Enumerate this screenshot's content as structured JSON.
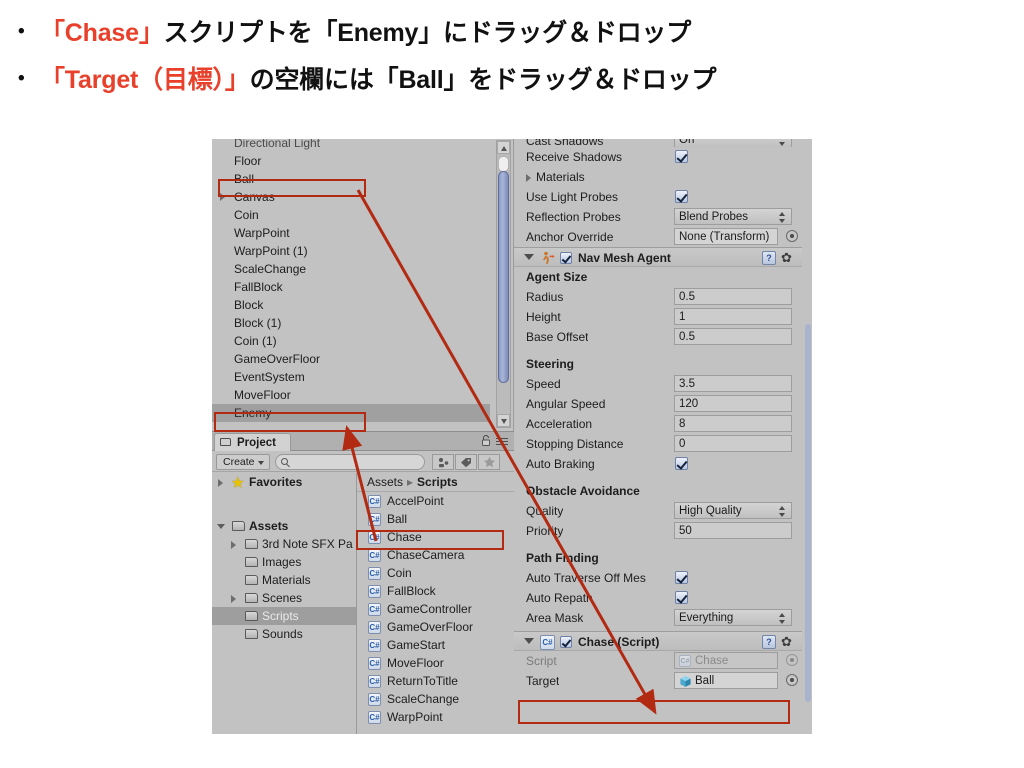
{
  "slide": {
    "bullets": [
      {
        "marker": "•",
        "parts": [
          {
            "text": "「Chase」",
            "accent": true
          },
          {
            "text": "スクリプトを「Enemy」にドラッグ＆ドロップ",
            "accent": false
          }
        ]
      },
      {
        "marker": "•",
        "parts": [
          {
            "text": "「Target（目標）」",
            "accent": true
          },
          {
            "text": "の空欄には「Ball」をドラッグ＆ドロップ",
            "accent": false
          }
        ]
      }
    ],
    "accent_color": "#E8402A",
    "text_color": "#111111"
  },
  "hierarchy": {
    "items": [
      {
        "label": "Directional Light",
        "expandable": false,
        "clipped": true,
        "selected": false
      },
      {
        "label": "Floor",
        "expandable": false,
        "selected": false
      },
      {
        "label": "Ball",
        "expandable": false,
        "selected": false,
        "highlighted": true
      },
      {
        "label": "Canvas",
        "expandable": true,
        "selected": false
      },
      {
        "label": "Coin",
        "expandable": false,
        "selected": false
      },
      {
        "label": "WarpPoint",
        "expandable": false,
        "selected": false
      },
      {
        "label": "WarpPoint (1)",
        "expandable": false,
        "selected": false
      },
      {
        "label": "ScaleChange",
        "expandable": false,
        "selected": false
      },
      {
        "label": "FallBlock",
        "expandable": false,
        "selected": false
      },
      {
        "label": "Block",
        "expandable": false,
        "selected": false
      },
      {
        "label": "Block (1)",
        "expandable": false,
        "selected": false
      },
      {
        "label": "Coin (1)",
        "expandable": false,
        "selected": false
      },
      {
        "label": "GameOverFloor",
        "expandable": false,
        "selected": false
      },
      {
        "label": "EventSystem",
        "expandable": false,
        "selected": false
      },
      {
        "label": "MoveFloor",
        "expandable": false,
        "selected": false
      },
      {
        "label": "Enemy",
        "expandable": false,
        "selected": true,
        "highlighted": true
      }
    ],
    "scrollbar": {
      "up_icon": "triangle-up-icon",
      "down_icon": "triangle-down-icon"
    }
  },
  "project": {
    "tab_label": "Project",
    "tab_icon": "folder-icon",
    "lock_icon": "lock-icon",
    "menu_icon": "hamburger-menu-icon",
    "create_label": "Create",
    "search_placeholder": "",
    "search_value": "",
    "toolbar_icons": [
      "filter-type-icon",
      "filter-label-icon",
      "favorites-star-icon"
    ],
    "tree": [
      {
        "label": "Favorites",
        "icon": "star-icon",
        "expandable": true,
        "bold": true,
        "indent": 0
      },
      {
        "label": "",
        "spacer": true
      },
      {
        "label": "Assets",
        "icon": "folder-icon",
        "expandable": true,
        "expanded": true,
        "bold": true,
        "indent": 0
      },
      {
        "label": "3rd Note SFX Pa",
        "icon": "folder-icon",
        "expandable": true,
        "indent": 1
      },
      {
        "label": "Images",
        "icon": "folder-icon",
        "expandable": false,
        "indent": 1
      },
      {
        "label": "Materials",
        "icon": "folder-icon",
        "expandable": false,
        "indent": 1
      },
      {
        "label": "Scenes",
        "icon": "folder-icon",
        "expandable": true,
        "indent": 1
      },
      {
        "label": "Scripts",
        "icon": "folder-icon",
        "expandable": false,
        "indent": 1,
        "selected": true
      },
      {
        "label": "Sounds",
        "icon": "folder-icon",
        "expandable": false,
        "indent": 1
      }
    ],
    "breadcrumb": {
      "root": "Assets",
      "separator": "▸",
      "current": "Scripts"
    },
    "assets": [
      {
        "label": "AccelPoint",
        "icon": "csharp-script-icon"
      },
      {
        "label": "Ball",
        "icon": "csharp-script-icon"
      },
      {
        "label": "Chase",
        "icon": "csharp-script-icon",
        "highlighted": true
      },
      {
        "label": "ChaseCamera",
        "icon": "csharp-script-icon"
      },
      {
        "label": "Coin",
        "icon": "csharp-script-icon"
      },
      {
        "label": "FallBlock",
        "icon": "csharp-script-icon"
      },
      {
        "label": "GameController",
        "icon": "csharp-script-icon"
      },
      {
        "label": "GameOverFloor",
        "icon": "csharp-script-icon"
      },
      {
        "label": "GameStart",
        "icon": "csharp-script-icon"
      },
      {
        "label": "MoveFloor",
        "icon": "csharp-script-icon"
      },
      {
        "label": "ReturnToTitle",
        "icon": "csharp-script-icon"
      },
      {
        "label": "ScaleChange",
        "icon": "csharp-script-icon"
      },
      {
        "label": "WarpPoint",
        "icon": "csharp-script-icon"
      }
    ]
  },
  "inspector": {
    "renderer_rows": [
      {
        "label": "Cast Shadows",
        "type": "popup",
        "value": "On",
        "clipped": true
      },
      {
        "label": "Receive Shadows",
        "type": "checkbox",
        "value": true
      },
      {
        "label": "Materials",
        "type": "foldout"
      },
      {
        "label": "Use Light Probes",
        "type": "checkbox",
        "value": true
      },
      {
        "label": "Reflection Probes",
        "type": "popup",
        "value": "Blend Probes"
      },
      {
        "label": "Anchor Override",
        "type": "object",
        "value": "None (Transform)"
      }
    ],
    "navmesh": {
      "title": "Nav Mesh Agent",
      "enabled": true,
      "icon": "navmesh-agent-icon",
      "help_icon": "help-book-icon",
      "gear_icon": "gear-icon",
      "groups": [
        {
          "header": "Agent Size",
          "rows": [
            {
              "label": "Radius",
              "type": "text",
              "value": "0.5"
            },
            {
              "label": "Height",
              "type": "text",
              "value": "1"
            },
            {
              "label": "Base Offset",
              "type": "text",
              "value": "0.5"
            }
          ]
        },
        {
          "header": "Steering",
          "rows": [
            {
              "label": "Speed",
              "type": "text",
              "value": "3.5"
            },
            {
              "label": "Angular Speed",
              "type": "text",
              "value": "120"
            },
            {
              "label": "Acceleration",
              "type": "text",
              "value": "8"
            },
            {
              "label": "Stopping Distance",
              "type": "text",
              "value": "0"
            },
            {
              "label": "Auto Braking",
              "type": "checkbox",
              "value": true
            }
          ]
        },
        {
          "header": "Obstacle Avoidance",
          "rows": [
            {
              "label": "Quality",
              "type": "popup",
              "value": "High Quality"
            },
            {
              "label": "Priority",
              "type": "text",
              "value": "50"
            }
          ]
        },
        {
          "header": "Path Finding",
          "rows": [
            {
              "label": "Auto Traverse Off Mes",
              "type": "checkbox",
              "value": true
            },
            {
              "label": "Auto Repath",
              "type": "checkbox",
              "value": true
            },
            {
              "label": "Area Mask",
              "type": "popup",
              "value": "Everything"
            }
          ]
        }
      ]
    },
    "chase": {
      "title": "Chase (Script)",
      "enabled": true,
      "icon": "csharp-script-icon",
      "help_icon": "help-book-icon",
      "gear_icon": "gear-icon",
      "rows": [
        {
          "label": "Script",
          "type": "object-dim",
          "value": "Chase",
          "icon": "csharp-script-icon"
        },
        {
          "label": "Target",
          "type": "object",
          "value": "Ball",
          "icon": "prefab-cube-icon",
          "highlighted": true
        }
      ]
    }
  },
  "annotations": {
    "color": "#B22A12",
    "boxes": [
      {
        "name": "ball-hierarchy-box"
      },
      {
        "name": "enemy-hierarchy-box"
      },
      {
        "name": "chase-asset-box"
      },
      {
        "name": "target-field-box"
      }
    ],
    "arrows": [
      {
        "name": "arrow-ball-to-target",
        "from": "Ball (Hierarchy)",
        "to": "Target field"
      },
      {
        "name": "arrow-chase-to-enemy",
        "from": "Chase (Scripts)",
        "to": "Enemy (Hierarchy)"
      }
    ]
  }
}
